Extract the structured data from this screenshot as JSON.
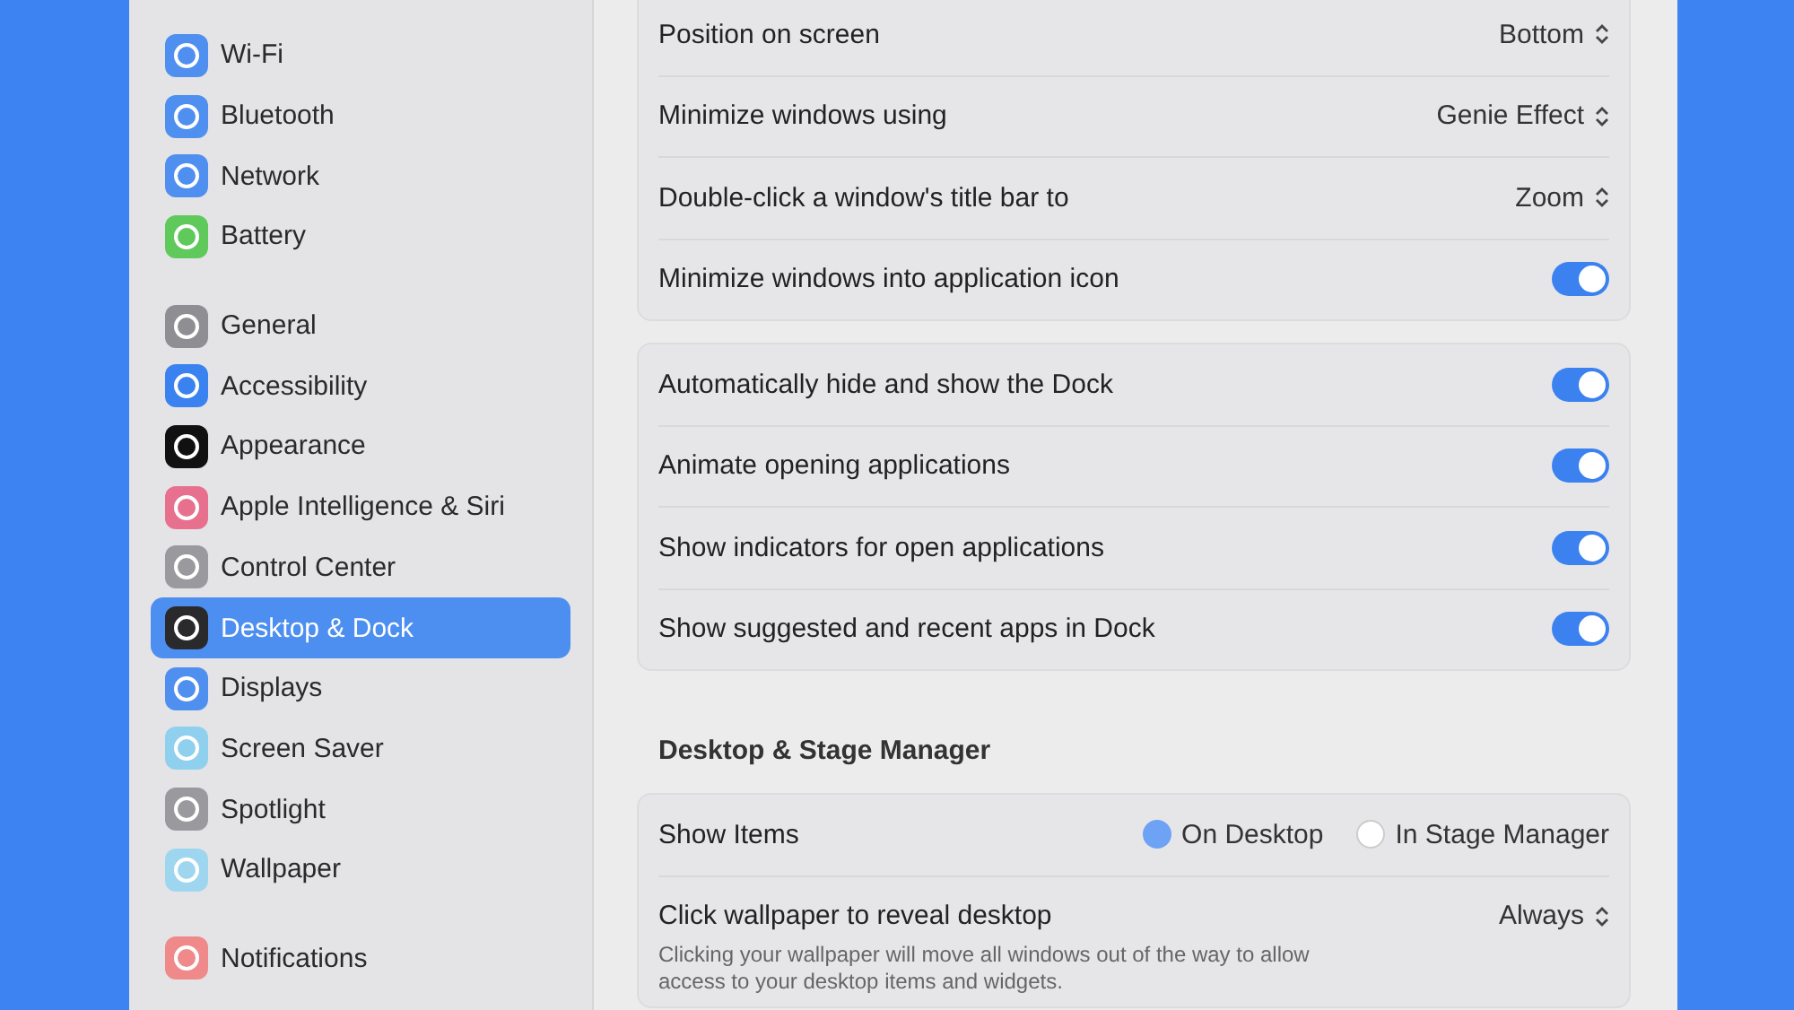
{
  "sidebar": {
    "groups": [
      {
        "items": [
          {
            "label": "Wi-Fi",
            "color": "#4f8ff0",
            "selected": false
          },
          {
            "label": "Bluetooth",
            "color": "#4f8ff0",
            "selected": false
          },
          {
            "label": "Network",
            "color": "#4f8ff0",
            "selected": false
          },
          {
            "label": "Battery",
            "color": "#5fc95c",
            "selected": false
          }
        ]
      },
      {
        "items": [
          {
            "label": "General",
            "color": "#8e8e93",
            "selected": false
          },
          {
            "label": "Accessibility",
            "color": "#3a82f0",
            "selected": false
          },
          {
            "label": "Appearance",
            "color": "#111111",
            "selected": false
          },
          {
            "label": "Apple Intelligence & Siri",
            "color": "#e7708f",
            "selected": false
          },
          {
            "label": "Control Center",
            "color": "#9a9a9e",
            "selected": false
          },
          {
            "label": "Desktop & Dock",
            "color": "#2a2a2c",
            "selected": true
          },
          {
            "label": "Displays",
            "color": "#4f8ff0",
            "selected": false
          },
          {
            "label": "Screen Saver",
            "color": "#8fd0ee",
            "selected": false
          },
          {
            "label": "Spotlight",
            "color": "#9a9a9e",
            "selected": false
          },
          {
            "label": "Wallpaper",
            "color": "#9fd6ef",
            "selected": false
          }
        ]
      },
      {
        "items": [
          {
            "label": "Notifications",
            "color": "#f08a8a",
            "selected": false
          }
        ]
      }
    ]
  },
  "content": {
    "sections": [
      {
        "rows": [
          {
            "kind": "popup",
            "label": "Position on screen",
            "value": "Bottom"
          },
          {
            "kind": "popup",
            "label": "Minimize windows using",
            "value": "Genie Effect"
          },
          {
            "kind": "popup",
            "label": "Double-click a window's title bar to",
            "value": "Zoom"
          },
          {
            "kind": "toggle",
            "label": "Minimize windows into application icon",
            "on": true
          }
        ]
      },
      {
        "rows": [
          {
            "kind": "toggle",
            "label": "Automatically hide and show the Dock",
            "on": true
          },
          {
            "kind": "toggle",
            "label": "Animate opening applications",
            "on": true
          },
          {
            "kind": "toggle",
            "label": "Show indicators for open applications",
            "on": true
          },
          {
            "kind": "toggle",
            "label": "Show suggested and recent apps in Dock",
            "on": true
          }
        ]
      },
      {
        "heading": "Desktop & Stage Manager",
        "rows": [
          {
            "kind": "radio",
            "label": "Show Items",
            "options": [
              {
                "label": "On Desktop",
                "selected": true
              },
              {
                "label": "In Stage Manager",
                "selected": false
              }
            ]
          },
          {
            "kind": "popup",
            "label": "Click wallpaper to reveal desktop",
            "value": "Always",
            "description": "Clicking your wallpaper will move all windows out of the way to allow access to your desktop items and widgets."
          }
        ]
      }
    ]
  }
}
